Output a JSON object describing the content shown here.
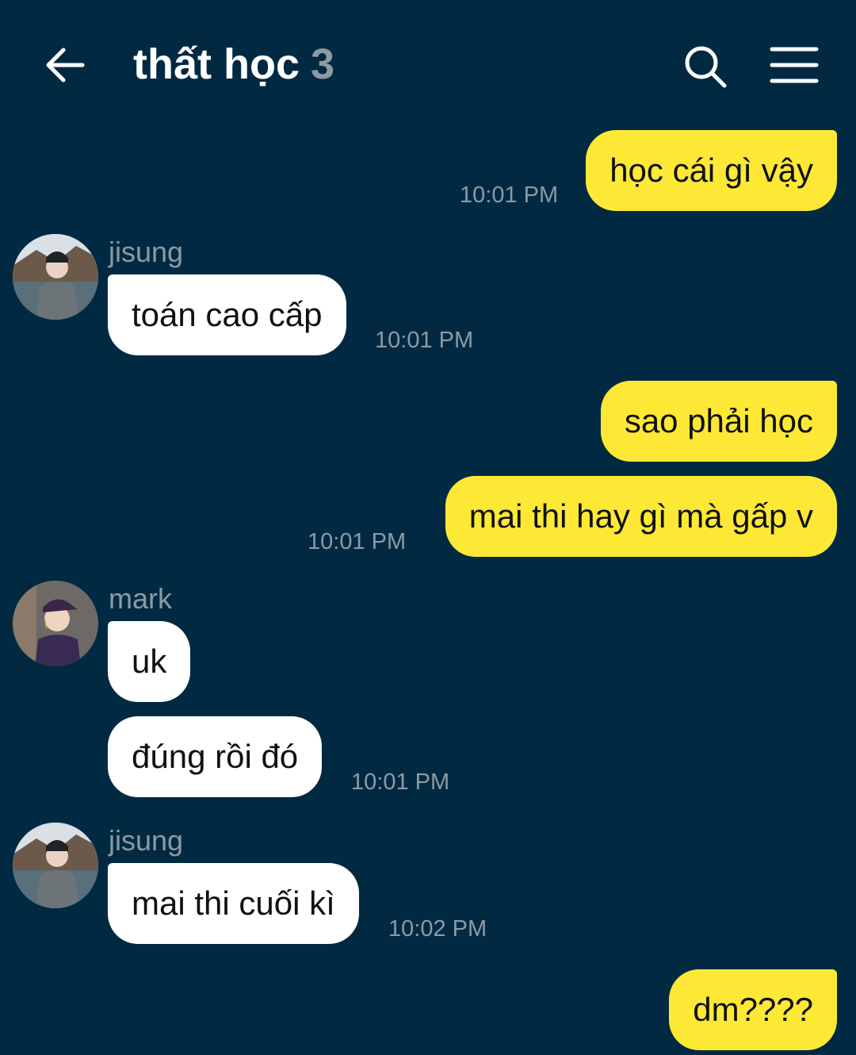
{
  "header": {
    "title": "thất học",
    "member_count": "3",
    "back_icon": "arrow-left-icon",
    "search_icon": "search-icon",
    "menu_icon": "hamburger-menu-icon"
  },
  "colors": {
    "background": "#012a42",
    "my_bubble": "#fde935",
    "their_bubble": "#ffffff",
    "meta_text": "#8c9aa4"
  },
  "messages": [
    {
      "sender": "me",
      "text": "học cái gì vậy",
      "time": "10:01 PM"
    },
    {
      "sender": "jisung",
      "sender_name": "jisung",
      "text": "toán cao cấp",
      "time": "10:01 PM"
    },
    {
      "sender": "me",
      "text": "sao phải học",
      "time": ""
    },
    {
      "sender": "me",
      "text": "mai thi hay gì mà gấp v",
      "time": "10:01 PM"
    },
    {
      "sender": "mark",
      "sender_name": "mark",
      "text": "uk",
      "time": ""
    },
    {
      "sender": "mark",
      "text": "đúng rồi đó",
      "time": "10:01 PM"
    },
    {
      "sender": "jisung",
      "sender_name": "jisung",
      "text": "mai thi cuối kì",
      "time": "10:02 PM"
    },
    {
      "sender": "me",
      "text": "dm????",
      "time": ""
    }
  ]
}
